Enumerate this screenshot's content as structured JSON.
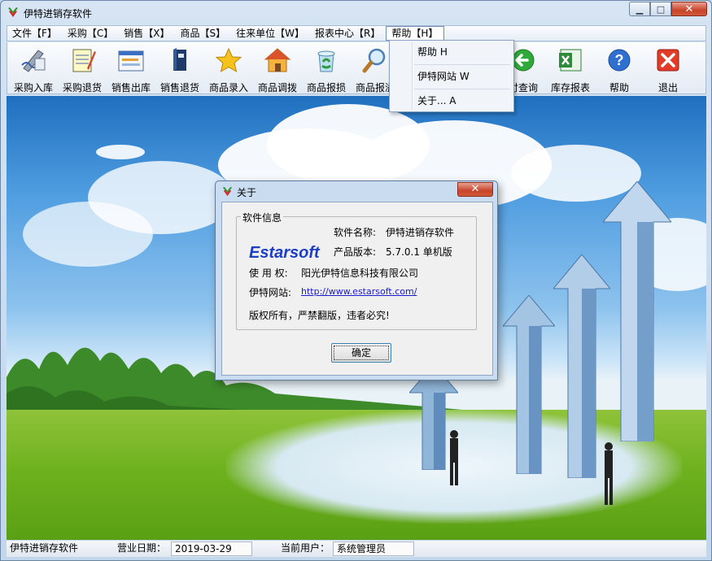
{
  "window": {
    "title": "伊特进销存软件"
  },
  "menu": [
    {
      "label": "文件【F】"
    },
    {
      "label": "采购【C】"
    },
    {
      "label": "销售【X】"
    },
    {
      "label": "商品【S】"
    },
    {
      "label": "往来单位【W】"
    },
    {
      "label": "报表中心【R】"
    },
    {
      "label": "帮助【H】",
      "active": true
    }
  ],
  "toolbar": [
    {
      "label": "采购入库",
      "icon": "pen-doc-icon"
    },
    {
      "label": "采购退货",
      "icon": "notepad-pen-icon"
    },
    {
      "label": "销售出库",
      "icon": "document-form-icon"
    },
    {
      "label": "销售退货",
      "icon": "book-icon"
    },
    {
      "label": "商品录入",
      "icon": "star-icon"
    },
    {
      "label": "商品调拨",
      "icon": "house-icon"
    },
    {
      "label": "商品报损",
      "icon": "recycle-bin-icon"
    },
    {
      "label": "商品报溢",
      "icon": "magnifier-icon"
    },
    {
      "label": "付查询",
      "icon": "green-arrow-icon"
    },
    {
      "label": "库存报表",
      "icon": "excel-icon"
    },
    {
      "label": "帮助",
      "icon": "help-icon"
    },
    {
      "label": "退出",
      "icon": "exit-icon"
    }
  ],
  "help_menu": {
    "items": [
      {
        "label": "帮助 H"
      },
      {
        "label": "伊特网站 W"
      },
      {
        "label": "关于... A"
      }
    ]
  },
  "about": {
    "title": "关于",
    "group_title": "软件信息",
    "brand": "Estarsoft",
    "name_label": "软件名称:",
    "name_value": "伊特进销存软件",
    "version_label": "产品版本:",
    "version_value": "5.7.0.1 单机版",
    "license_label": "使 用 权:",
    "license_value": "阳光伊特信息科技有限公司",
    "site_label": "伊特网站:",
    "site_value": "http://www.estarsoft.com/",
    "copyright": "版权所有，严禁翻版，违者必究!",
    "ok_label": "确定"
  },
  "status": {
    "app_name": "伊特进销存软件",
    "date_label": "营业日期：",
    "date_value": "2019-03-29",
    "user_label": "当前用户：",
    "user_value": "系统管理员"
  },
  "colors": {
    "brand_blue": "#1b3fc4",
    "close_red": "#c7442a",
    "link_blue": "#1a1acc"
  }
}
